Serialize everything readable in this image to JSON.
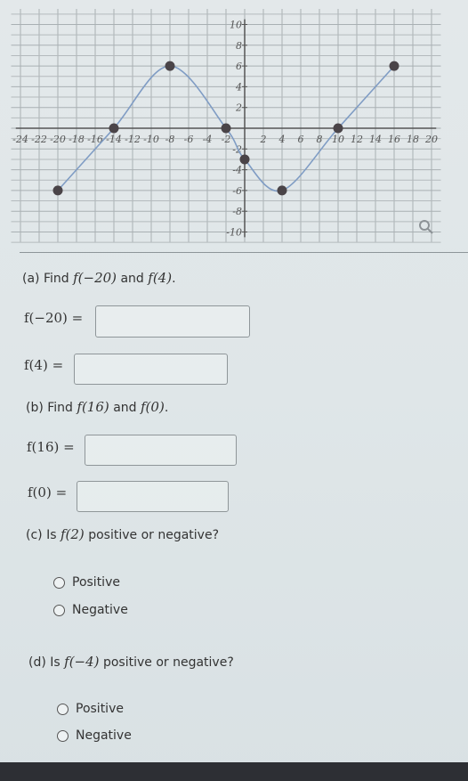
{
  "chart_data": {
    "type": "line",
    "title": "",
    "xlabel": "",
    "ylabel": "",
    "xlim": [
      -24,
      20
    ],
    "ylim": [
      -10,
      10
    ],
    "grid": true,
    "x_ticks": [
      -24,
      -22,
      -20,
      -18,
      -16,
      -14,
      -12,
      -10,
      -8,
      -6,
      -4,
      -2,
      2,
      4,
      6,
      8,
      10,
      12,
      14,
      16,
      18,
      20
    ],
    "y_ticks": [
      -10,
      -8,
      -6,
      -4,
      -2,
      2,
      4,
      6,
      8,
      10
    ],
    "points": [
      {
        "x": -20,
        "y": -6
      },
      {
        "x": -14,
        "y": 0
      },
      {
        "x": -8,
        "y": 6
      },
      {
        "x": -2,
        "y": 0
      },
      {
        "x": 0,
        "y": -3
      },
      {
        "x": 4,
        "y": -6
      },
      {
        "x": 10,
        "y": 0
      },
      {
        "x": 16,
        "y": 6
      }
    ],
    "curve_color": "#7f9cc4",
    "point_color": "#4a4448"
  },
  "graph_tools": {
    "zoom_icon": "magnifier-icon"
  },
  "part_a": {
    "prefix": "(a) Find ",
    "e1": "f(−20)",
    "mid": " and ",
    "e2": "f(4)",
    "suffix": ".",
    "row1_label": "f(−20) =",
    "row1_value": "",
    "row2_label": "f(4) =",
    "row2_value": ""
  },
  "part_b": {
    "prefix": "(b) Find ",
    "e1": "f(16)",
    "mid": " and ",
    "e2": "f(0)",
    "suffix": ".",
    "row1_label": "f(16) =",
    "row1_value": "",
    "row2_label": "f(0) =",
    "row2_value": ""
  },
  "part_c": {
    "prefix": "(c) Is ",
    "e1": "f(2)",
    "suffix": " positive or negative?",
    "options": [
      "Positive",
      "Negative"
    ]
  },
  "part_d": {
    "prefix": "(d) Is ",
    "e1": "f(−4)",
    "suffix": " positive or negative?",
    "options": [
      "Positive",
      "Negative"
    ]
  }
}
